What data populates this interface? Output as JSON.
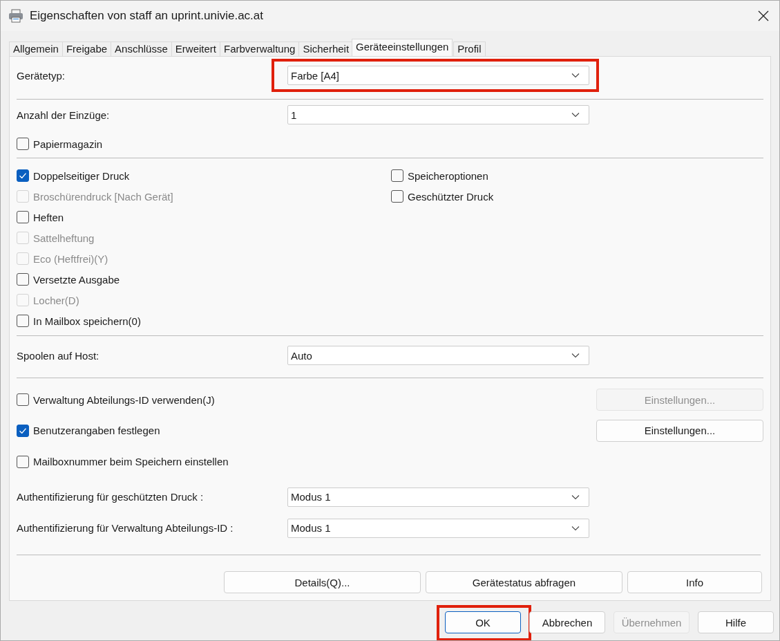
{
  "window": {
    "title": "Eigenschaften von staff an uprint.univie.ac.at"
  },
  "tabs": [
    {
      "label": "Allgemein",
      "selected": false
    },
    {
      "label": "Freigabe",
      "selected": false
    },
    {
      "label": "Anschlüsse",
      "selected": false
    },
    {
      "label": "Erweitert",
      "selected": false
    },
    {
      "label": "Farbverwaltung",
      "selected": false
    },
    {
      "label": "Sicherheit",
      "selected": false
    },
    {
      "label": "Geräteeinstellungen",
      "selected": true
    },
    {
      "label": "Profil",
      "selected": false
    }
  ],
  "device_type": {
    "label": "Gerätetyp:",
    "value": "Farbe [A4]",
    "highlighted": true
  },
  "intakes": {
    "label": "Anzahl der Einzüge:",
    "value": "1"
  },
  "paper_magazine": {
    "label": "Papiermagazin",
    "checked": false,
    "disabled": false
  },
  "options_left": [
    {
      "label": "Doppelseitiger Druck",
      "checked": true,
      "disabled": false
    },
    {
      "label": "Broschürendruck [Nach Gerät]",
      "checked": false,
      "disabled": true
    },
    {
      "label": "Heften",
      "checked": false,
      "disabled": false
    },
    {
      "label": "Sattelheftung",
      "checked": false,
      "disabled": true
    },
    {
      "label": "Eco (Heftfrei)(Y)",
      "checked": false,
      "disabled": true
    },
    {
      "label": "Versetzte Ausgabe",
      "checked": false,
      "disabled": false
    },
    {
      "label": "Locher(D)",
      "checked": false,
      "disabled": true
    },
    {
      "label": "In Mailbox speichern(0)",
      "checked": false,
      "disabled": false
    }
  ],
  "options_right": [
    {
      "label": "Speicheroptionen",
      "checked": false,
      "disabled": false
    },
    {
      "label": "Geschützter Druck",
      "checked": false,
      "disabled": false
    }
  ],
  "spool": {
    "label": "Spoolen auf Host:",
    "value": "Auto"
  },
  "account_rows": [
    {
      "label": "Verwaltung Abteilungs-ID verwenden(J)",
      "checked": false,
      "disabled": false,
      "button": {
        "label": "Einstellungen...",
        "disabled": true
      }
    },
    {
      "label": "Benutzerangaben festlegen",
      "checked": true,
      "disabled": false,
      "button": {
        "label": "Einstellungen...",
        "disabled": false
      }
    },
    {
      "label": "Mailboxnummer beim Speichern einstellen",
      "checked": false,
      "disabled": false
    }
  ],
  "auth": [
    {
      "label": "Authentifizierung für geschützten Druck :",
      "value": "Modus 1"
    },
    {
      "label": "Authentifizierung für Verwaltung Abteilungs-ID :",
      "value": "Modus 1"
    }
  ],
  "action_buttons": [
    {
      "label": "Details(Q)..."
    },
    {
      "label": "Gerätestatus abfragen"
    },
    {
      "label": "Info"
    }
  ],
  "dialog_buttons": [
    {
      "label": "OK",
      "disabled": false,
      "default": true,
      "highlighted": true
    },
    {
      "label": "Abbrechen",
      "disabled": false,
      "default": false,
      "highlighted": false
    },
    {
      "label": "Übernehmen",
      "disabled": true,
      "default": false,
      "highlighted": false
    },
    {
      "label": "Hilfe",
      "disabled": false,
      "default": false,
      "highlighted": false
    }
  ]
}
